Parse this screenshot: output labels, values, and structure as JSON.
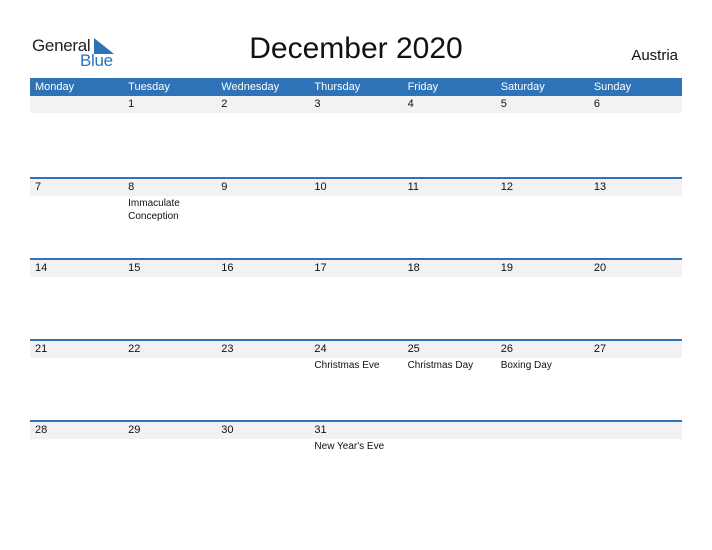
{
  "logo": {
    "word1": "General",
    "word2": "Blue"
  },
  "title": "December 2020",
  "country": "Austria",
  "colors": {
    "accent": "#2e72b8",
    "strip": "#f2f2f2"
  },
  "weekdays": [
    "Monday",
    "Tuesday",
    "Wednesday",
    "Thursday",
    "Friday",
    "Saturday",
    "Sunday"
  ],
  "weeks": [
    {
      "days": [
        "",
        "1",
        "2",
        "3",
        "4",
        "5",
        "6"
      ],
      "events": [
        "",
        "",
        "",
        "",
        "",
        "",
        ""
      ]
    },
    {
      "days": [
        "7",
        "8",
        "9",
        "10",
        "11",
        "12",
        "13"
      ],
      "events": [
        "",
        "Immaculate Conception",
        "",
        "",
        "",
        "",
        ""
      ]
    },
    {
      "days": [
        "14",
        "15",
        "16",
        "17",
        "18",
        "19",
        "20"
      ],
      "events": [
        "",
        "",
        "",
        "",
        "",
        "",
        ""
      ]
    },
    {
      "days": [
        "21",
        "22",
        "23",
        "24",
        "25",
        "26",
        "27"
      ],
      "events": [
        "",
        "",
        "",
        "Christmas Eve",
        "Christmas Day",
        "Boxing Day",
        ""
      ]
    },
    {
      "days": [
        "28",
        "29",
        "30",
        "31",
        "",
        "",
        ""
      ],
      "events": [
        "",
        "",
        "",
        "New Year's Eve",
        "",
        "",
        ""
      ]
    }
  ]
}
